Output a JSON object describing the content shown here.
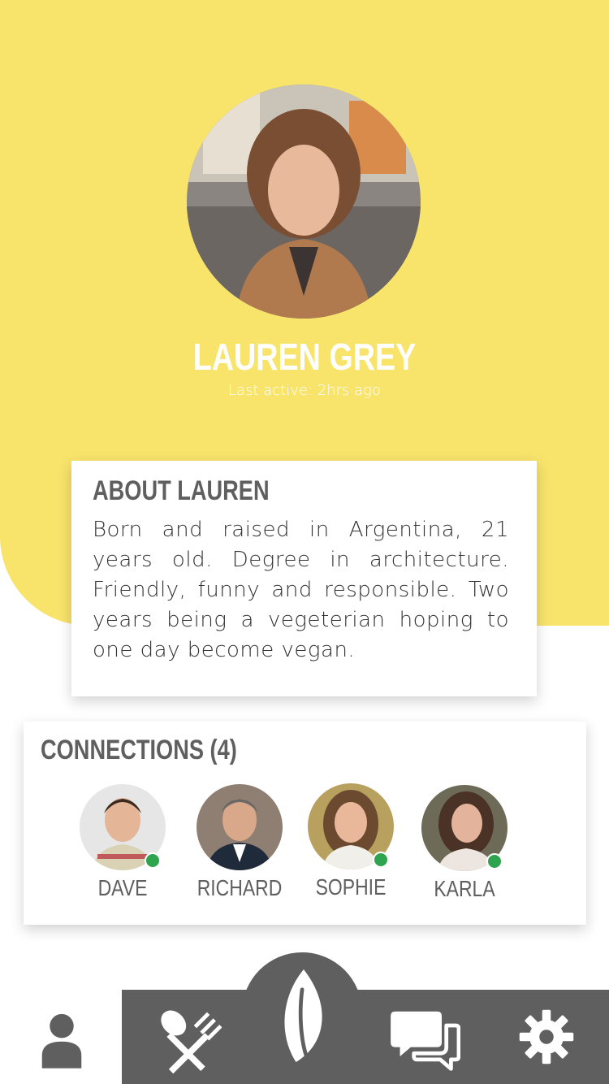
{
  "profile": {
    "name": "LAUREN GREY",
    "last_active": "Last active: 2hrs ago"
  },
  "about": {
    "title": "ABOUT LAUREN",
    "text": "Born and raised in Argentina, 21 years old.  Degree in architecture. Friendly, funny and responsible. Two years being a vegeterian hoping to one day become vegan."
  },
  "connections": {
    "title": "CONNECTIONS (4)",
    "items": [
      {
        "name": "DAVE",
        "online": true
      },
      {
        "name": "RICHARD",
        "online": false
      },
      {
        "name": "SOPHIE",
        "online": true
      },
      {
        "name": "KARLA",
        "online": true
      }
    ]
  },
  "nav": {
    "items": [
      {
        "icon": "user-icon",
        "active": true
      },
      {
        "icon": "utensils-icon",
        "active": false
      },
      {
        "icon": "leaf-icon",
        "active": false
      },
      {
        "icon": "chat-icon",
        "active": false
      },
      {
        "icon": "gear-icon",
        "active": false
      }
    ]
  },
  "colors": {
    "accent_yellow": "#f8e36b",
    "nav_gray": "#5f5f5f",
    "online_green": "#2ea44f"
  }
}
